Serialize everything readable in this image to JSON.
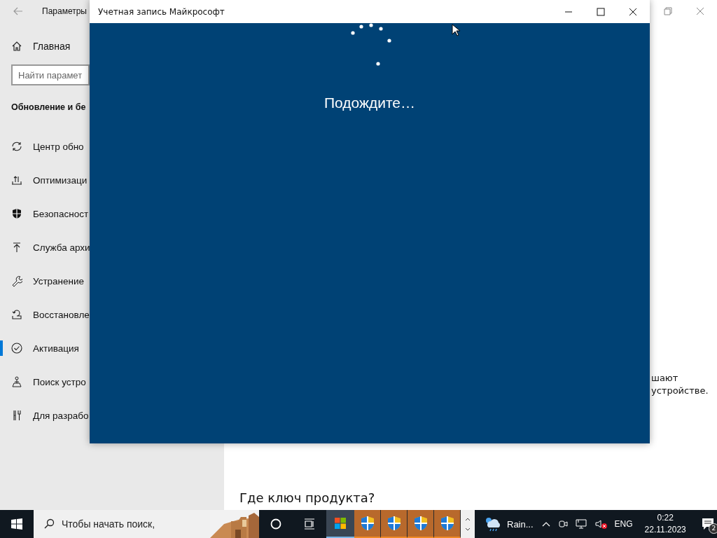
{
  "settings_window": {
    "title": "Параметры",
    "sidebar": {
      "home": "Главная",
      "search": {
        "placeholder": "Найти парамет"
      },
      "section_title": "Обновление и бе",
      "items": [
        {
          "label": "Центр обно",
          "selected": false
        },
        {
          "label": "Оптимизаци",
          "selected": false
        },
        {
          "label": "Безопасност",
          "selected": false
        },
        {
          "label": "Служба архи",
          "selected": false
        },
        {
          "label": "Устранение",
          "selected": false
        },
        {
          "label": "Восстановле",
          "selected": false
        },
        {
          "label": "Активация",
          "selected": true
        },
        {
          "label": "Поиск устро",
          "selected": false
        },
        {
          "label": "Для разрабо",
          "selected": false
        }
      ]
    },
    "content": {
      "text_lines": [
        "шают",
        "устройстве."
      ],
      "heading": "Где ключ продукта?"
    }
  },
  "dialog": {
    "title": "Учетная запись Майкрософт",
    "message": "Подождите…"
  },
  "taskbar": {
    "search_placeholder": "Чтобы начать поиск,",
    "apps": [
      {
        "kind": "store",
        "active": true,
        "flashing": false
      },
      {
        "kind": "shield",
        "active": false,
        "flashing": true
      },
      {
        "kind": "shield",
        "active": false,
        "flashing": true
      },
      {
        "kind": "shield",
        "active": false,
        "flashing": true
      },
      {
        "kind": "shield",
        "active": false,
        "flashing": true
      }
    ],
    "weather": "Rain...",
    "language": "ENG",
    "time": "0:22",
    "date": "22.11.2023",
    "notifications": "2"
  }
}
